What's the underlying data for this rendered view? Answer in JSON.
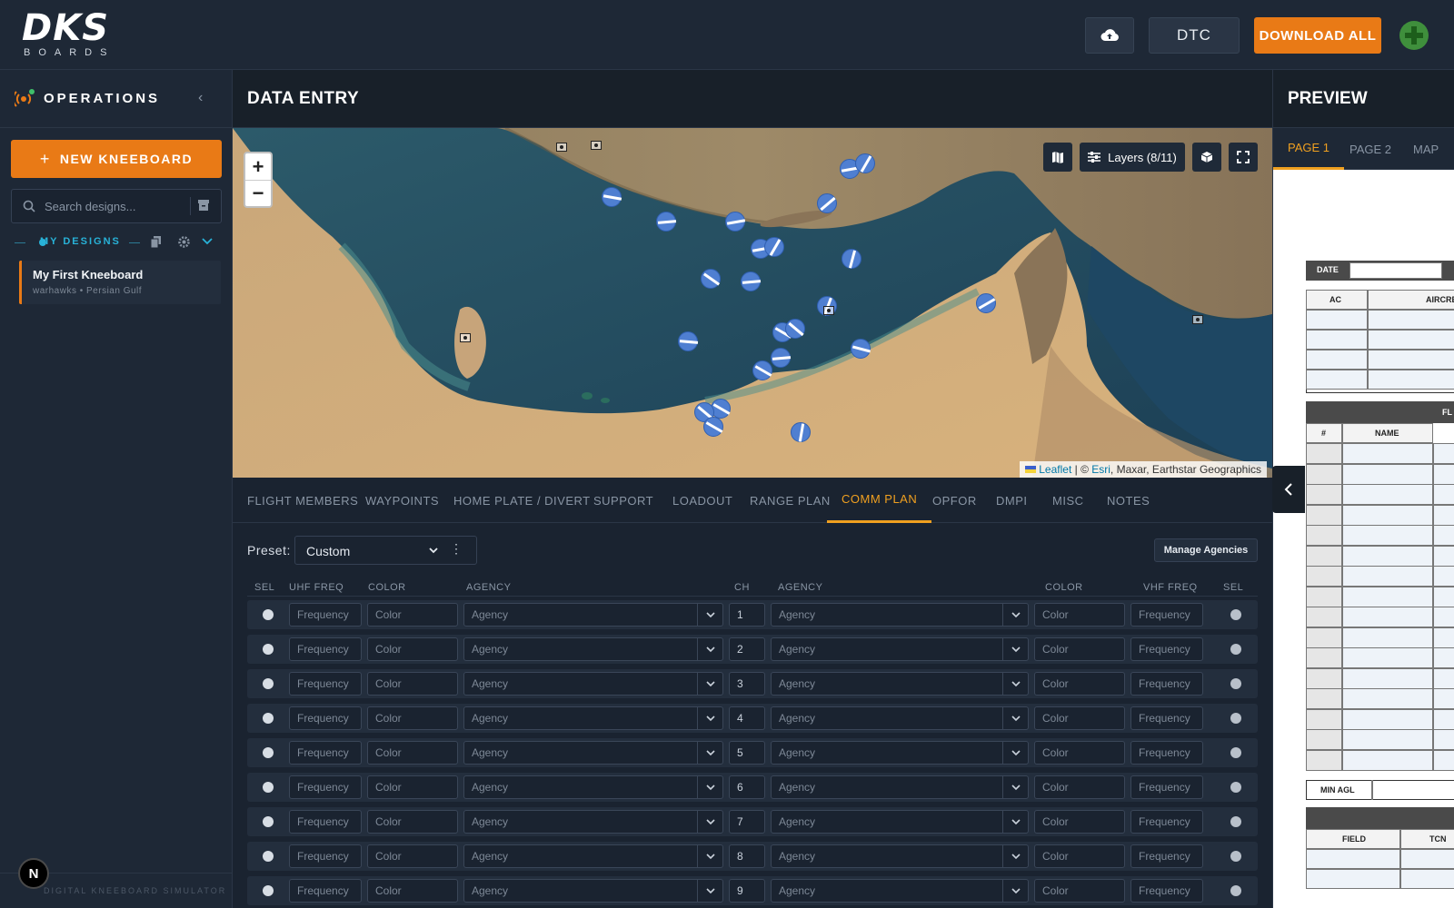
{
  "brand": {
    "name": "DKS",
    "sub": "BOARDS"
  },
  "topbar": {
    "dtc_label": "DTC",
    "download_label": "DOWNLOAD ALL"
  },
  "sidebar": {
    "title": "OPERATIONS",
    "new_button": "NEW KNEEBOARD",
    "search_placeholder": "Search designs...",
    "designs_label": "MY DESIGNS",
    "design": {
      "name": "My First Kneeboard",
      "meta": "warhawks • Persian Gulf"
    },
    "footer": "DIGITAL KNEEBOARD SIMULATOR"
  },
  "main": {
    "title": "DATA ENTRY",
    "map": {
      "layers_label": "Layers (8/11)",
      "attrib_leaflet": "Leaflet",
      "attrib_sep": " | © ",
      "attrib_esri": "Esri",
      "attrib_rest": ", Maxar, Earthstar Geographics"
    },
    "tabs": [
      "FLIGHT MEMBERS",
      "WAYPOINTS",
      "HOME PLATE / DIVERT",
      "SUPPORT",
      "LOADOUT",
      "RANGE PLAN",
      "COMM PLAN",
      "OPFOR",
      "DMPI",
      "MISC",
      "NOTES"
    ],
    "active_tab": "COMM PLAN",
    "comm": {
      "preset_label": "Preset:",
      "preset_value": "Custom",
      "manage_label": "Manage Agencies",
      "headers": {
        "sel": "SEL",
        "uhf": "UHF FREQ",
        "color": "COLOR",
        "agency": "AGENCY",
        "ch": "CH",
        "vhf": "VHF FREQ"
      },
      "placeholders": {
        "freq": "Frequency",
        "color": "Color",
        "agency": "Agency"
      },
      "channels": [
        "1",
        "2",
        "3",
        "4",
        "5",
        "6",
        "7",
        "8",
        "9"
      ]
    }
  },
  "preview": {
    "title": "PREVIEW",
    "tabs": [
      "PAGE 1",
      "PAGE 2",
      "MAP"
    ],
    "sheet": {
      "date": "DATE",
      "ac": "AC",
      "aircraft": "AIRCRE",
      "fl": "FL",
      "num": "#",
      "name": "NAME",
      "min_agl": "MIN AGL",
      "field": "FIELD",
      "tcn": "TCN"
    }
  },
  "colors": {
    "accent": "#e97a16",
    "tab_active": "#f0a020",
    "cyan": "#28b2d8"
  }
}
